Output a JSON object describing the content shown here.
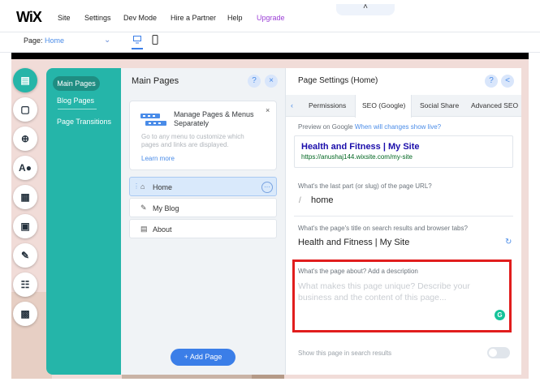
{
  "topbar": {
    "logo": "WiX",
    "menu": [
      "Site",
      "Settings",
      "Dev Mode",
      "Hire a Partner",
      "Help",
      "Upgrade"
    ],
    "collapse_glyph": "˄"
  },
  "subbar": {
    "page_label": "Page:",
    "page_value": "Home"
  },
  "rail_icons": [
    "pages-icon",
    "background-icon",
    "add-icon",
    "design-icon",
    "apps-icon",
    "media-icon",
    "blog-icon",
    "bookings-icon",
    "store-icon"
  ],
  "sidenav": {
    "items": [
      "Main Pages",
      "Blog Pages",
      "Page Transitions"
    ]
  },
  "main_pages": {
    "title": "Main Pages",
    "help": "?",
    "close": "×",
    "info": {
      "title": "Manage Pages & Menus Separately",
      "desc": "Go to any menu to customize which pages and links are displayed.",
      "link": "Learn more",
      "close": "×"
    },
    "pages": [
      {
        "label": "Home",
        "icon": "⌂"
      },
      {
        "label": "My Blog",
        "icon": "✎"
      },
      {
        "label": "About",
        "icon": "▤"
      }
    ],
    "add_button": "+ Add Page"
  },
  "page_settings": {
    "title": "Page Settings (Home)",
    "help": "?",
    "back": "<",
    "tabs": [
      "Permissions",
      "SEO (Google)",
      "Social Share",
      "Advanced SEO"
    ],
    "preview_label": "Preview on Google",
    "preview_link": "When will changes show live?",
    "preview_title": "Health and Fitness | My Site",
    "preview_url": "https://anushaj144.wixsite.com/my-site",
    "slug_label": "What's the last part (or slug) of the page URL?",
    "slug_value": "home",
    "title_label": "What's the page's title on search results and browser tabs?",
    "title_value": "Health and Fitness | My Site",
    "desc_label": "What's the page about? Add a description",
    "desc_placeholder": "What makes this page unique? Describe your business and the content of this page...",
    "show_label": "Show this page in search results"
  }
}
